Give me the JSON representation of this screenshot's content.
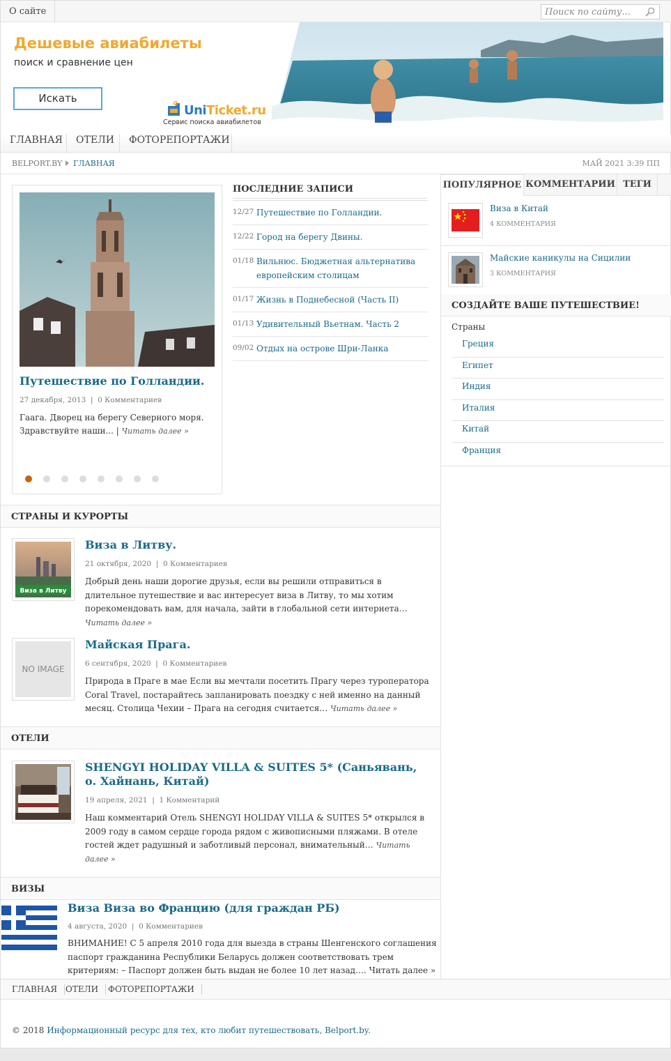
{
  "topbar": {
    "about": "О сайте",
    "search_placeholder": "Поиск по сайту..."
  },
  "banner": {
    "title": "Дешевые авиабилеты",
    "subtitle": "поиск и сравнение цен",
    "button": "Искать",
    "logo_brand_a": "Uni",
    "logo_brand_b": "Ticket.ru",
    "logo_tagline": "Сервис поиска авиабилетов"
  },
  "nav": [
    "ГЛАВНАЯ",
    "ОТЕЛИ",
    "ФОТОРЕПОРТАЖИ"
  ],
  "breadcrumb": {
    "site": "BELPORT.BY",
    "current": "ГЛАВНАЯ",
    "date": "МАЙ 2021 3:39 ПП"
  },
  "featured": {
    "title": "Путешествие по Голландии.",
    "date": "27 декабря, 2013",
    "comments": "0 Комментариев",
    "excerpt": "Гаага. Дворец на берегу Северного моря. Здравствуйте наши...",
    "more": "Читать далее »",
    "slides": 8,
    "active_slide": 1
  },
  "latest": {
    "heading": "ПОСЛЕДНИЕ ЗАПИСИ",
    "items": [
      {
        "date": "12/27",
        "title": "Путешествие по Голландии."
      },
      {
        "date": "12/22",
        "title": "Город на берегу Двины."
      },
      {
        "date": "01/18",
        "title": "Вильнюс. Бюджетная альтернатива европейским столицам"
      },
      {
        "date": "01/17",
        "title": "Жизнь в Поднебесной (Часть II)"
      },
      {
        "date": "01/13",
        "title": "Удивительный Вьетнам. Часть 2"
      },
      {
        "date": "09/02",
        "title": "Отдых на острове Шри-Ланка"
      }
    ]
  },
  "sidebar": {
    "tabs": [
      "ПОПУЛЯРНОЕ",
      "КОММЕНТАРИИ",
      "ТЕГИ"
    ],
    "popular": [
      {
        "title": "Виза в Китай",
        "comments": "4 КОММЕНТАРИЯ"
      },
      {
        "title": "Майские каникулы на Сицилии",
        "comments": "3 КОММЕНТАРИЯ"
      }
    ],
    "create_heading": "СОЗДАЙТЕ ВАШЕ ПУТЕШЕСТВИЕ!",
    "countries_label": "Страны",
    "countries": [
      "Греция",
      "Египет",
      "Индия",
      "Италия",
      "Китай",
      "Франция"
    ]
  },
  "sections": {
    "countries": {
      "heading": "СТРАНЫ И КУРОРТЫ",
      "posts": [
        {
          "title": "Виза в Литву.",
          "date": "21 октября, 2020",
          "comments": "0 Комментариев",
          "excerpt": "Добрый день наши дорогие друзья, если вы решили отправиться в длительное путешествие и вас интересует виза в Литву, то мы хотим порекомендовать вам, для начала, зайти в глобальной сети интернета…",
          "more": "Читать далее »",
          "thumb_caption": "Виза в Литву"
        },
        {
          "title": "Майская Прага.",
          "date": "6 сентября, 2020",
          "comments": "0 Комментариев",
          "excerpt": "Природа в Праге в мае  Если вы мечтали посетить Прагу через туроператора Coral Travel, постарайтесь запланировать поездку с ней именно на данный месяц. Столица Чехии – Прага  на сегодня считается…",
          "more": "Читать далее »",
          "thumb_caption": "NO IMAGE"
        }
      ]
    },
    "hotels": {
      "heading": "ОТЕЛИ",
      "post": {
        "title": "SHENGYI HOLIDAY VILLA & SUITES 5* (Саньявань, о. Хайнань, Китай)",
        "date": "19 апреля, 2021",
        "comments": "1 Комментарий",
        "excerpt": "Наш комментарий Отель SHENGYI HOLIDAY VILLA & SUITES 5* открылся в 2009 году в самом сердце города рядом с живописными пляжами. В отеле гостей ждет радушный и заботливый персонал, внимательный…",
        "more": "Читать далее »"
      }
    },
    "visas": {
      "heading": "ВИЗЫ",
      "post": {
        "title": "Виза Виза во Францию (для граждан РБ)",
        "date": "4 августа, 2020",
        "comments": "0 Комментариев",
        "excerpt": "ВНИМАНИЕ! С 5 апреля 2010 года для выезда в страны Шенгенского соглашения паспорт гражданина Республики Беларусь должен соответствовать трем критериям: – Паспорт должен быть выдан не более 10 лет назад…. Читать далее »"
      }
    }
  },
  "footer": {
    "nav": [
      "ГЛАВНАЯ",
      "ОТЕЛИ",
      "ФОТОРЕПОРТАЖИ"
    ],
    "copyright": "© 2018",
    "link": "Информационный ресурс для тех, кто любит путешествовать, Belport.by."
  }
}
